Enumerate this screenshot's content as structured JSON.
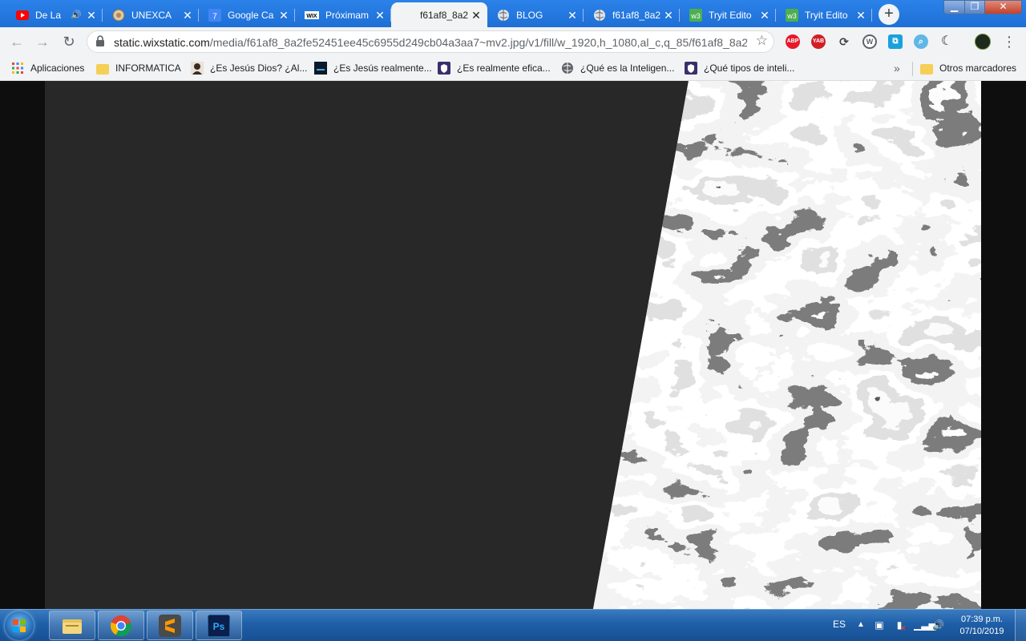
{
  "browser": {
    "tabs": [
      {
        "title": "De La",
        "icon": "youtube-icon",
        "audio": true,
        "active": false
      },
      {
        "title": "UNEXCA",
        "icon": "university-seal-icon",
        "active": false
      },
      {
        "title": "Google Ca",
        "icon": "google-calendar-icon",
        "badge": "7",
        "active": false
      },
      {
        "title": "Próximam",
        "icon": "wix-icon",
        "badge": "WIX",
        "active": false
      },
      {
        "title": "f61af8_8a2",
        "icon": "image-tab-icon",
        "active": true
      },
      {
        "title": "BLOG",
        "icon": "globe-icon",
        "active": false
      },
      {
        "title": "f61af8_8a2",
        "icon": "globe-icon",
        "active": false
      },
      {
        "title": "Tryit Edito",
        "icon": "w3schools-icon",
        "active": false
      },
      {
        "title": "Tryit Edito",
        "icon": "w3schools-icon",
        "active": false
      }
    ],
    "new_tab": "+",
    "address": {
      "host": "static.wixstatic.com",
      "path": "/media/f61af8_8a2fe52451ee45c6955d249cb04a3aa7~mv2.jpg/v1/fill/w_1920,h_1080,al_c,q_85/f61af8_8a2..."
    },
    "extensions": [
      {
        "name": "adblock-plus-icon",
        "label": "ABP",
        "color": "#e6192a"
      },
      {
        "name": "youtube-adblock-icon",
        "label": "YAB",
        "color": "#d11f26"
      },
      {
        "name": "sync-extension-icon",
        "label": "",
        "color": "#3c4043"
      },
      {
        "name": "wordpress-icon",
        "label": "",
        "color": "#5f6368"
      },
      {
        "name": "translate-extension-icon",
        "label": "",
        "color": "#1aa1db"
      },
      {
        "name": "search-extension-icon",
        "label": "",
        "color": "#5fb7e8"
      },
      {
        "name": "dark-mode-icon",
        "label": "",
        "color": "#202124"
      },
      {
        "name": "profile-avatar-icon",
        "label": "",
        "color": "#1e2a1c"
      }
    ],
    "bookmarks": [
      {
        "label": "Aplicaciones",
        "icon": "apps-grid-icon"
      },
      {
        "label": "INFORMATICA",
        "icon": "folder-icon"
      },
      {
        "label": "¿Es Jesús Dios? ¿Al...",
        "icon": "portrait-icon"
      },
      {
        "label": "¿Es Jesús realmente...",
        "icon": "dark-site-icon"
      },
      {
        "label": "¿Es realmente efica...",
        "icon": "shield-site-icon"
      },
      {
        "label": "¿Qué es la Inteligen...",
        "icon": "globe-icon"
      },
      {
        "label": "¿Qué tipos de inteli...",
        "icon": "shield-site-icon"
      }
    ],
    "bookmarks_more": "»",
    "other_bookmarks": "Otros marcadores"
  },
  "taskbar": {
    "pinned": [
      {
        "name": "file-explorer-icon",
        "color": "#e8c25a"
      },
      {
        "name": "chrome-icon",
        "color": "#4285f4"
      },
      {
        "name": "sublime-text-icon",
        "color": "#ff9800"
      },
      {
        "name": "photoshop-icon",
        "color": "#0b1f4a",
        "label": "Ps"
      }
    ],
    "language": "ES",
    "time": "07:39 p.m.",
    "date": "07/10/2019"
  }
}
